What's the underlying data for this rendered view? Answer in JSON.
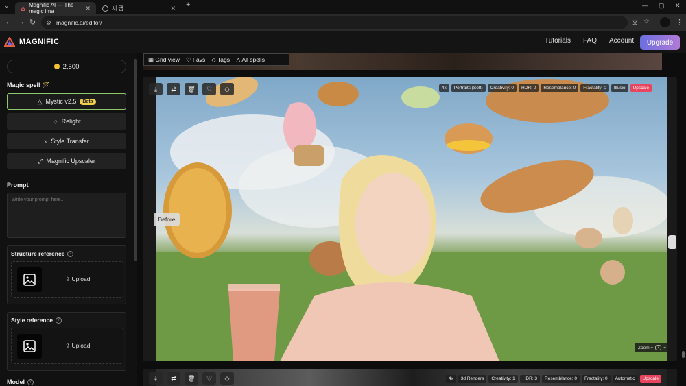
{
  "browser": {
    "tabs": [
      {
        "title": "Magnific AI — The magic ima"
      },
      {
        "title": "새 탭"
      }
    ],
    "url": "magnific.ai/editor/"
  },
  "app": {
    "logo": "MAGNIFIC",
    "nav": [
      "Tutorials",
      "FAQ",
      "Account"
    ],
    "upgrade": "Upgrade"
  },
  "sidebar": {
    "credits": "2,500",
    "magic_spell_title": "Magic spell 🪄",
    "spells": [
      {
        "label": "Mystic v2.5",
        "badge": "Beta",
        "icon": "triangle-icon"
      },
      {
        "label": "Relight",
        "icon": "sun-icon"
      },
      {
        "label": "Style Transfer",
        "icon": "double-chevron-icon"
      },
      {
        "label": "Magnific Upscaler",
        "icon": "expand-icon"
      }
    ],
    "prompt_title": "Prompt",
    "prompt_placeholder": "Write your prompt here...",
    "structure_reference": "Structure reference",
    "style_reference": "Style reference",
    "upload": "Upload",
    "model_title": "Model"
  },
  "filters": [
    "Grid view",
    "Favs",
    "Tags",
    "All spells"
  ],
  "card1": {
    "tags": [
      "4x",
      "Portraits (Soft)",
      "Creativity: 0",
      "HDR: 0",
      "Resemblance: 0",
      "Fractality: 0",
      "Illusio",
      "Upscale"
    ],
    "before": "Before",
    "zoom_label": "Zoom =",
    "zoom_key1": "z",
    "zoom_plus": "+",
    "zoom_key2": "wheel"
  },
  "card2": {
    "tags": [
      "4x",
      "3d Renders",
      "Creativity: 1",
      "HDR: 3",
      "Resemblance: 0",
      "Fractality: 0",
      "Automatic",
      "Upscale"
    ]
  },
  "colors": {
    "accent": "#8ec868",
    "upscale": "#e9455e",
    "beta": "#f1cf4a"
  }
}
